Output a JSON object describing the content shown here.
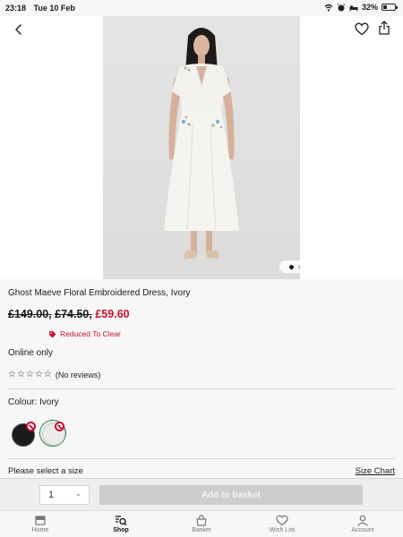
{
  "status_bar": {
    "time": "23:18",
    "date": "Tue 10 Feb",
    "battery": "32%",
    "battery_level": 0.32
  },
  "product": {
    "title": "Ghost Maeve Floral Embroidered Dress, Ivory",
    "price_original": "£149.00,",
    "price_reduced_1": "£74.50,",
    "price_now": "£59.60",
    "reduced_label": "Reduced To Clear",
    "availability": "Online only",
    "reviews": "(No reviews)",
    "rating_stars": 0,
    "colour_label": "Colour: Ivory",
    "image_count": 4,
    "active_image": 0
  },
  "size": {
    "prompt": "Please select a size",
    "chart_link": "Size Chart"
  },
  "basket": {
    "quantity": "1",
    "add_label": "Add to basket"
  },
  "tabs": [
    {
      "label": "Home",
      "icon": "home-icon",
      "active": false
    },
    {
      "label": "Shop",
      "icon": "shop-search-icon",
      "active": true
    },
    {
      "label": "Basket",
      "icon": "basket-icon",
      "active": false
    },
    {
      "label": "Wish List",
      "icon": "heart-icon",
      "active": false
    },
    {
      "label": "Account",
      "icon": "account-icon",
      "active": false
    }
  ],
  "colors": {
    "sale_red": "#c8102e",
    "selected_green": "#1f8a3a"
  }
}
